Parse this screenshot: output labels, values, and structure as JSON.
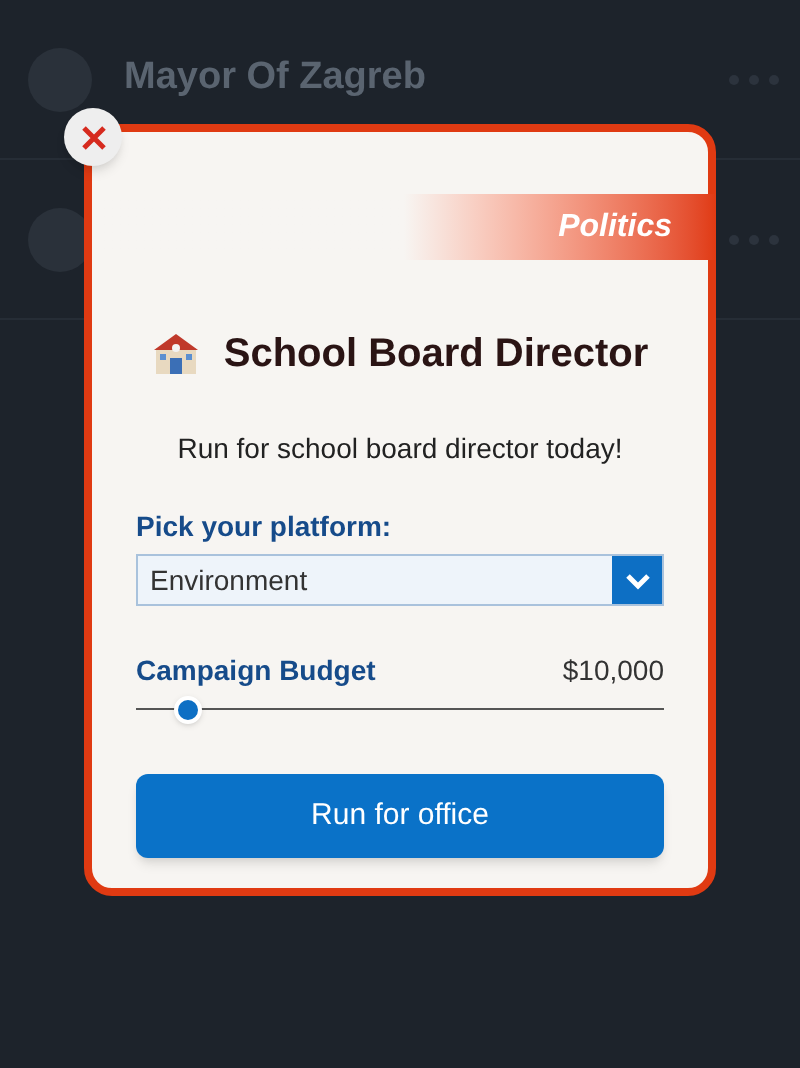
{
  "background_list": {
    "rows": [
      {
        "title": "Mayor Of Zagreb"
      },
      {}
    ]
  },
  "modal": {
    "category": "Politics",
    "title": "School Board Director",
    "description": "Run for school board director today!",
    "platform": {
      "label": "Pick your platform:",
      "value": "Environment"
    },
    "budget": {
      "label": "Campaign Budget",
      "reading": "$10,000",
      "level": 0.1
    },
    "button": "Run for office"
  }
}
